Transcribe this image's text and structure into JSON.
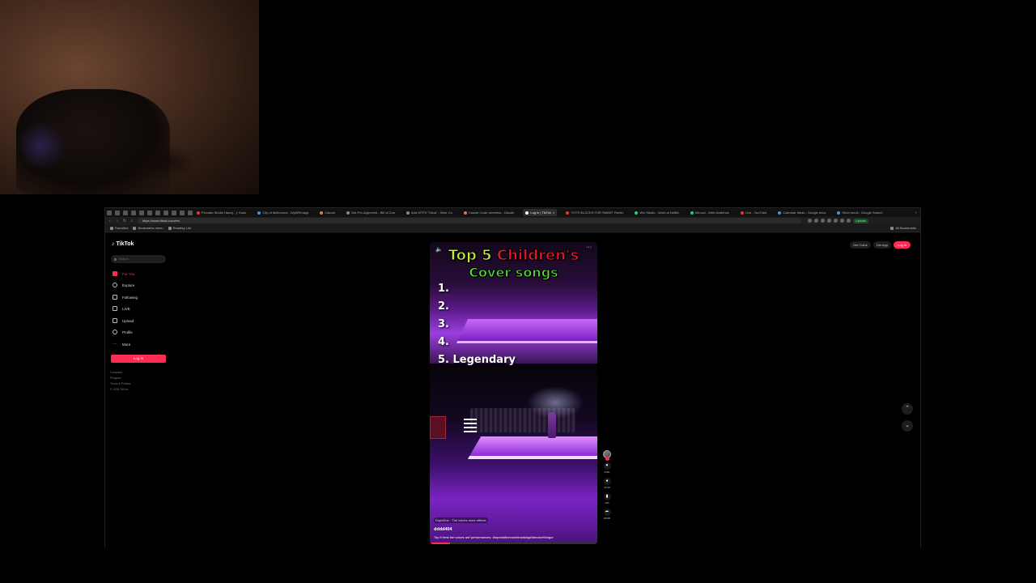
{
  "browser": {
    "tabs": [
      {
        "label": "Peccato Studio Hand(…) Youtu",
        "color": "#e33"
      },
      {
        "label": "City of Melbourne - MyWRmapp",
        "color": "#4a90e2"
      },
      {
        "label": "Claude",
        "color": "#d97757"
      },
      {
        "label": "Get Pre-Approved - Bill of Cue",
        "color": "#888"
      },
      {
        "label": "Add WTFS \"Deck\" - Beer Co",
        "color": "#888"
      },
      {
        "label": "Claude Code overview - Claude",
        "color": "#d97757"
      },
      {
        "label": "Log in | TikTok",
        "color": "#fff",
        "active": true
      },
      {
        "label": "TOYS BLOCKS FOR SMART Remix",
        "color": "#e33"
      },
      {
        "label": "Wix Studio - Work at Netflix",
        "color": "#2ecc71"
      },
      {
        "label": "Meucci - Web Audience",
        "color": "#2ecc71"
      },
      {
        "label": "Live - YouTube",
        "color": "#e33"
      },
      {
        "label": "Calendar ideas - Google docs",
        "color": "#4a90e2"
      },
      {
        "label": "Short scroll - Google Search",
        "color": "#4a90e2"
      }
    ],
    "url": "https://www.tiktok.com/en/",
    "update_label": "Update",
    "bookmarks": [
      "Favorites",
      "Bookmarks menu",
      "Reading List"
    ],
    "all_bookmarks": "All Bookmarks"
  },
  "tiktok": {
    "logo": "TikTok",
    "search_placeholder": "Search",
    "nav": [
      {
        "label": "For You",
        "icon": "home-icon",
        "active": true
      },
      {
        "label": "Explore",
        "icon": "compass-icon"
      },
      {
        "label": "Following",
        "icon": "following-icon"
      },
      {
        "label": "LIVE",
        "icon": "live-icon"
      },
      {
        "label": "Upload",
        "icon": "upload-icon"
      },
      {
        "label": "Profile",
        "icon": "profile-icon"
      },
      {
        "label": "More",
        "icon": "more-icon"
      }
    ],
    "login_button": "Log in",
    "footer": [
      "Company",
      "Program",
      "Terms & Policies",
      "© 2025 TikTok"
    ],
    "top_right": {
      "get_coins": "Get Coins",
      "get_app": "Get App",
      "login": "Log in"
    },
    "accent": "#fe2c55"
  },
  "video": {
    "title_part1": "Top 5 ",
    "title_part2": "Children's",
    "title_line2": "Cover songs",
    "ranks": [
      "1.",
      "2.",
      "3.",
      "4.",
      "5. Legendary"
    ],
    "sound_chip": "DopeDux · The voices more effects",
    "author": "dddd404",
    "caption": "Top 5 best the voices are\"performances. #toprankthevoice#ranking#thevoicethingor",
    "progress": 0.12
  },
  "actions": {
    "like": "235K",
    "comment": "15.4K",
    "save": "33K",
    "share": "36000"
  }
}
